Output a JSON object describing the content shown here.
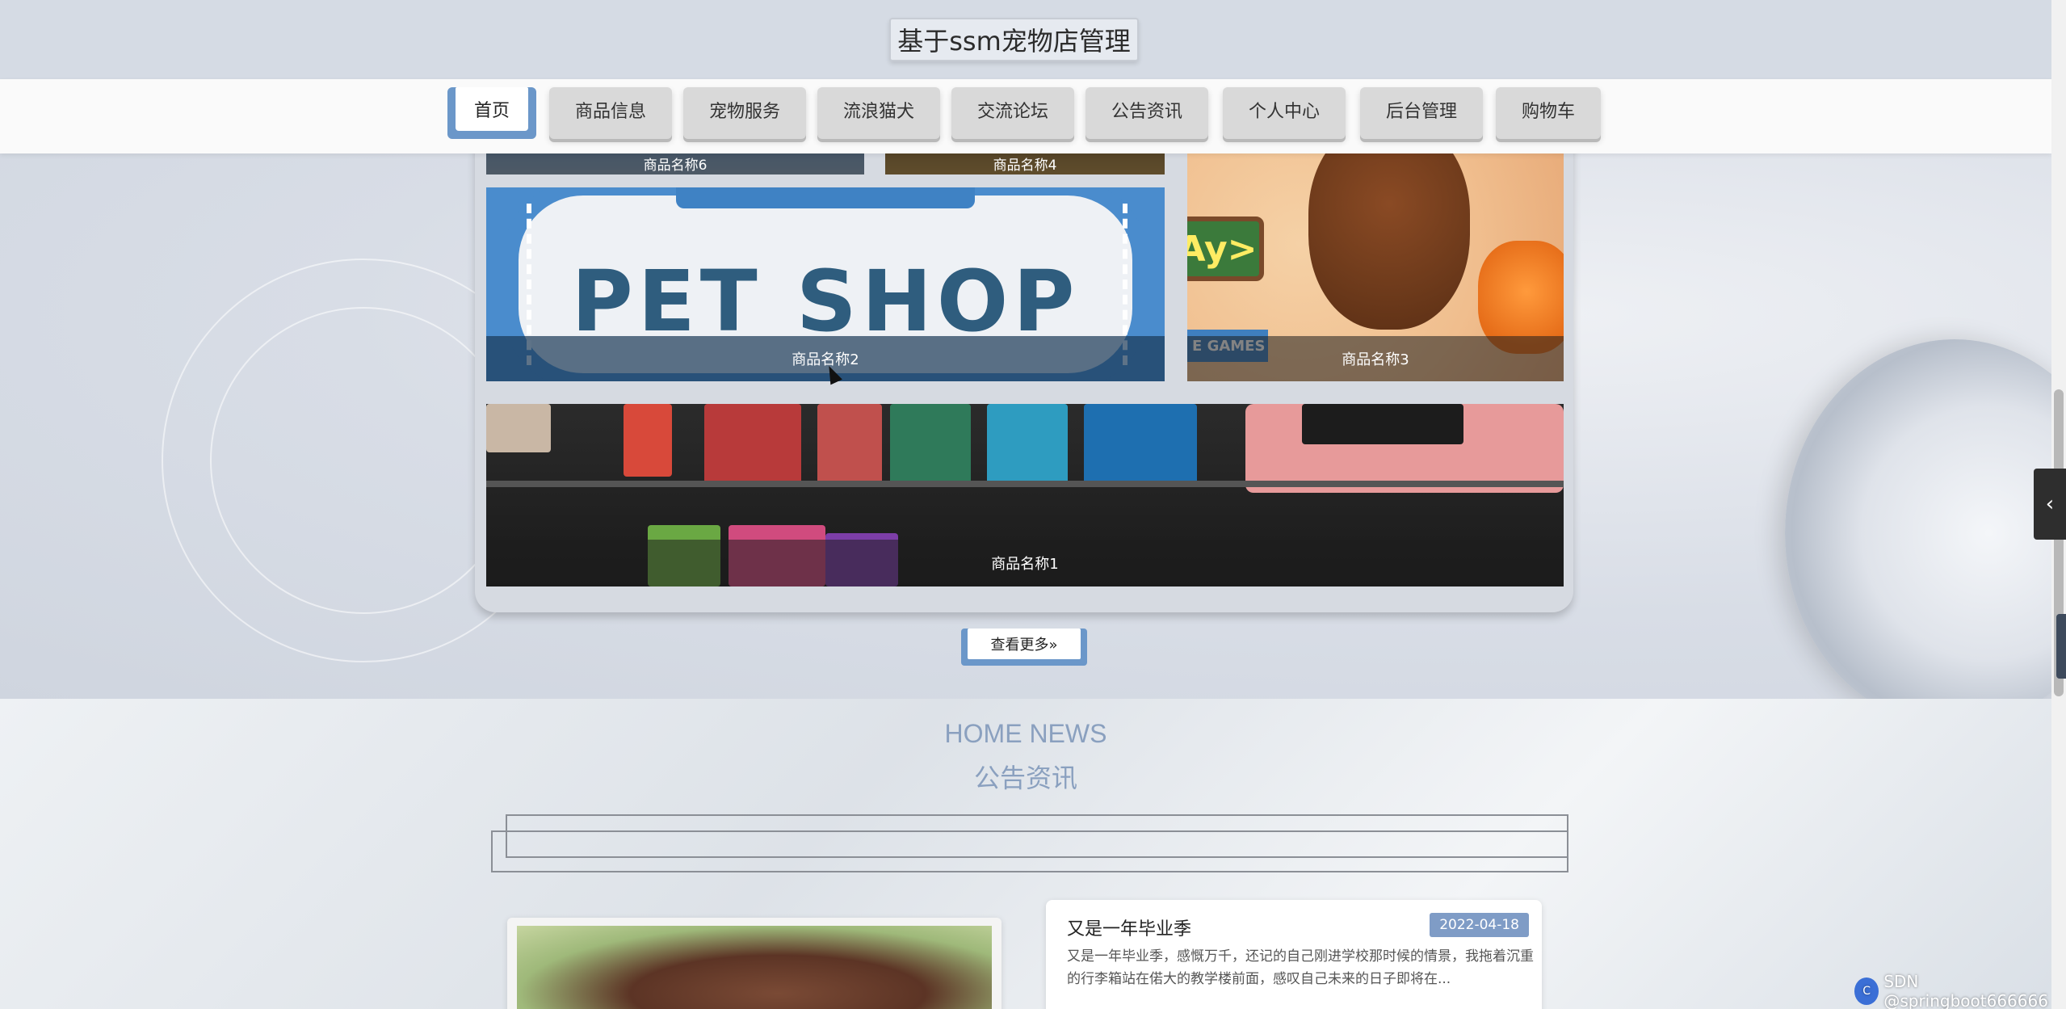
{
  "site": {
    "title": "基于ssm宠物店管理"
  },
  "nav": {
    "items": [
      {
        "label": "首页",
        "active": true
      },
      {
        "label": "商品信息"
      },
      {
        "label": "宠物服务"
      },
      {
        "label": "流浪猫犬"
      },
      {
        "label": "交流论坛"
      },
      {
        "label": "公告资讯"
      },
      {
        "label": "个人中心"
      },
      {
        "label": "后台管理"
      },
      {
        "label": "购物车"
      }
    ]
  },
  "products": {
    "tiles": [
      {
        "caption": "商品名称6"
      },
      {
        "caption": "商品名称4"
      },
      {
        "caption": "商品名称2",
        "image_text": "PET SHOP"
      },
      {
        "caption": "商品名称3",
        "image_text": "Ay>",
        "image_text_2": "E GAMES"
      },
      {
        "caption": "商品名称1"
      }
    ],
    "more_label": "查看更多»"
  },
  "news": {
    "title_en": "HOME NEWS",
    "title_cn": "公告资讯",
    "items": [
      {
        "title": "又是一年毕业季",
        "date": "2022-04-18",
        "summary": "又是一年毕业季，感慨万千，还记的自己刚进学校那时候的情景，我拖着沉重的行李箱站在偌大的教学楼前面，感叹自己未来的日子即将在..."
      }
    ]
  },
  "side_toggle_icon": "chevron-left-icon",
  "watermark": {
    "logo_text": "C",
    "text": "SDN @springboot666666"
  },
  "colors": {
    "accent": "#6b97c9",
    "nav_button": "#d9d9d9",
    "news_title": "#8aa0bf",
    "date_badge": "#7f9cc6"
  }
}
